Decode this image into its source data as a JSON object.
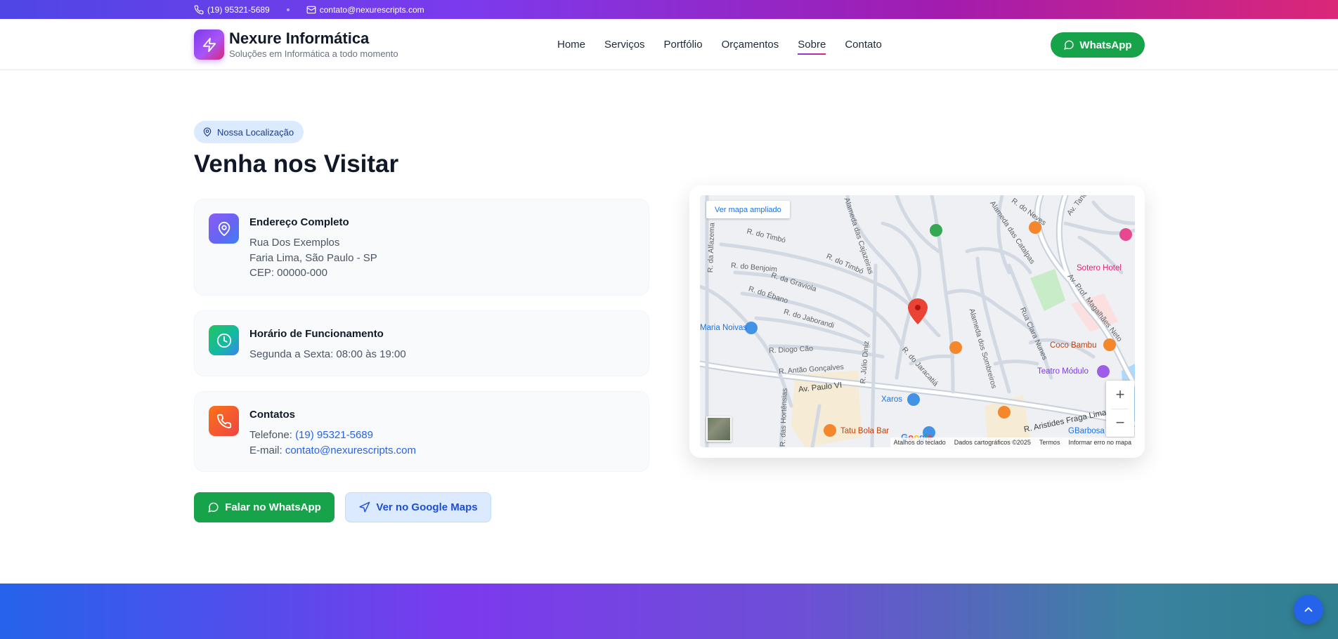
{
  "topbar": {
    "phone": "(19) 95321-5689",
    "email": "contato@nexurescripts.com",
    "phone_icon": "phone-icon",
    "mail_icon": "mail-icon"
  },
  "header": {
    "brand_name": "Nexure Informática",
    "brand_tagline": "Soluções em Informática a todo momento",
    "logo_icon": "lightning-icon",
    "nav": [
      "Home",
      "Serviços",
      "Portfólio",
      "Orçamentos",
      "Sobre",
      "Contato"
    ],
    "active_nav": "Sobre",
    "whatsapp_label": "WhatsApp"
  },
  "location": {
    "badge": "Nossa Localização",
    "title": "Venha nos Visitar",
    "address": {
      "title": "Endereço Completo",
      "line1": "Rua Dos Exemplos",
      "line2": "Faria Lima, São Paulo - SP",
      "line3": "CEP: 00000-000"
    },
    "hours": {
      "title": "Horário de Funcionamento",
      "line1": "Segunda a Sexta: 08:00 às 19:00"
    },
    "contacts": {
      "title": "Contatos",
      "phone_label": "Telefone:",
      "phone": "(19) 95321-5689",
      "email_label": "E-mail:",
      "email": "contato@nexurescripts.com"
    },
    "whatsapp_button": "Falar no WhatsApp",
    "maps_button": "Ver no Google Maps"
  },
  "map": {
    "view_larger": "Ver mapa ampliado",
    "streets": {
      "alfazema": "R. da Alfazema",
      "timbo1": "R. do Timbó",
      "timbo2": "R. do Timbó",
      "benjoim": "R. do Benjoim",
      "graviola": "R. da Graviola",
      "ebano": "R. do Ébano",
      "jaborandi": "R. do Jaborandi",
      "diogo": "R. Diogo Cão",
      "antao": "R. Antão Gonçalves",
      "julio": "R. Júlio Diniz",
      "jaracatia": "R. do Jaracatiá",
      "cajazeiras": "Alameda das Cajazeiras",
      "catalpas": "Alameda das Catalpas",
      "sombreiros": "Alameda dos Sombreiros",
      "clara": "Rua Clara Nunes",
      "neves": "R. do Neves",
      "tancredo": "Av. Tancredo",
      "magalhaes": "Av. Prof. Magalhães Neto",
      "paulo": "Av. Paulo VI",
      "aristides": "R. Aristides Fraga Lima",
      "hortensias": "R. das Hortênsias"
    },
    "pois": {
      "noivas": "Maria Noivas",
      "sotero": "Sotero Hotel",
      "coco": "Coco Bambu",
      "teatro": "Teatro Módulo",
      "xaros": "Xaros",
      "tatu": "Tatu Bola Bar",
      "gbarbosa": "GBarbosa Costa"
    },
    "google": "Google",
    "attribution": {
      "shortcuts": "Atalhos do teclado",
      "data": "Dados cartográficos ©2025",
      "terms": "Termos",
      "report": "Informar erro no mapa"
    },
    "zoom_in": "+",
    "zoom_out": "−"
  }
}
